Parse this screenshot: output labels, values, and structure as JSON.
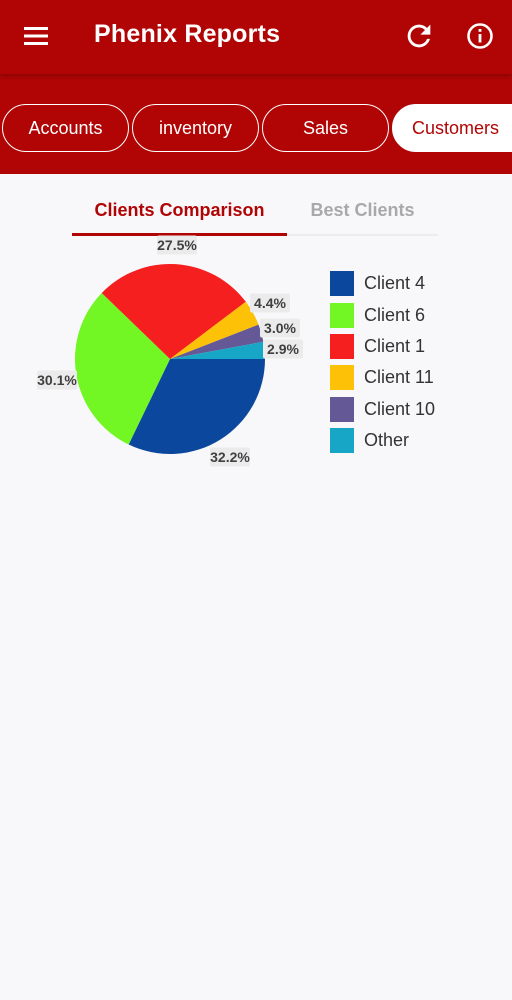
{
  "header": {
    "title": "Phenix Reports",
    "menu_icon": "menu-icon",
    "refresh_icon": "refresh-icon",
    "info_icon": "info-icon"
  },
  "report_tabs": [
    {
      "label": "Accounts",
      "active": false
    },
    {
      "label": "inventory",
      "active": false
    },
    {
      "label": "Sales",
      "active": false
    },
    {
      "label": "Customers",
      "active": true
    }
  ],
  "sub_tabs": [
    {
      "label": "Clients Comparison",
      "active": true
    },
    {
      "label": "Best Clients",
      "active": false
    }
  ],
  "colors": {
    "brand": "#b10505",
    "background": "#f8f8fa"
  },
  "chart_data": {
    "type": "pie",
    "slices": [
      {
        "label": "Client 4",
        "value": 32.2,
        "display": "32.2%",
        "color": "#0b479c"
      },
      {
        "label": "Client 6",
        "value": 30.1,
        "display": "30.1%",
        "color": "#72f624"
      },
      {
        "label": "Client 1",
        "value": 27.5,
        "display": "27.5%",
        "color": "#f51f1f"
      },
      {
        "label": "Client 11",
        "value": 4.4,
        "display": "4.4%",
        "color": "#fdc108"
      },
      {
        "label": "Client 10",
        "value": 3.0,
        "display": "3.0%",
        "color": "#645896"
      },
      {
        "label": "Other",
        "value": 2.9,
        "display": "2.9%",
        "color": "#17a6c6"
      }
    ],
    "legend_position": "right"
  }
}
